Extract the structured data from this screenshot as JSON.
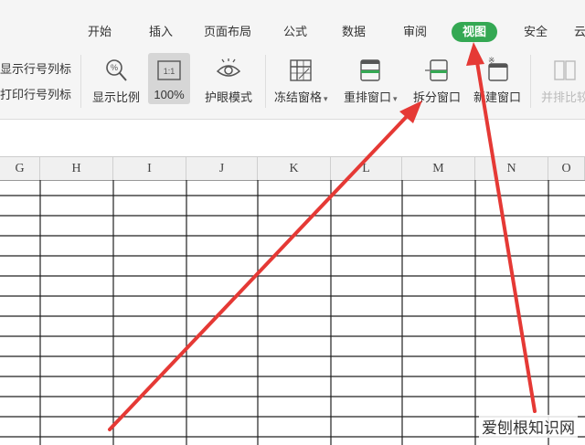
{
  "menu": {
    "tabs": [
      {
        "label": "开始"
      },
      {
        "label": "插入"
      },
      {
        "label": "页面布局"
      },
      {
        "label": "公式"
      },
      {
        "label": "数据"
      },
      {
        "label": "审阅"
      },
      {
        "label": "视图",
        "active": true
      },
      {
        "label": "安全"
      },
      {
        "label": "云"
      }
    ]
  },
  "ribbon": {
    "show_row_col_headers": "显示行号列标",
    "print_row_col_headers": "打印行号列标",
    "zoom_label": "显示比例",
    "zoom_value": "100%",
    "zoom_ratio_icon": "1:1",
    "eye_mode": "护眼模式",
    "freeze_panes": "冻结窗格",
    "rearrange_windows": "重排窗口",
    "split_window": "拆分窗口",
    "new_window": "新建窗口",
    "side_by_side": "并排比较"
  },
  "sheet": {
    "columns": [
      "G",
      "H",
      "I",
      "J",
      "K",
      "L",
      "M",
      "N",
      "O"
    ]
  },
  "watermark": "爱刨根知识网",
  "colors": {
    "active_tab": "#34a853",
    "arrow": "#e53935",
    "ribbon_bg": "#f5f5f5"
  }
}
